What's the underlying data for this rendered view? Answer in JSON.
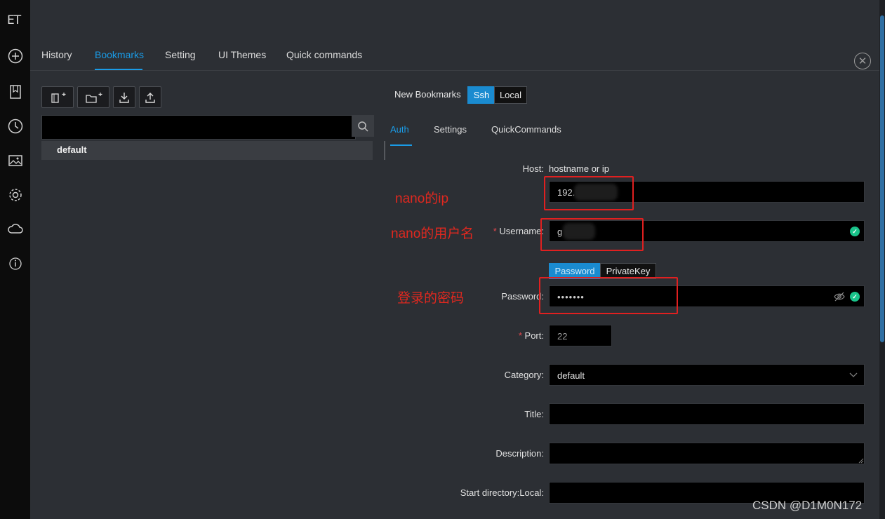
{
  "rail": {
    "logo": "ET",
    "icons": [
      "add-icon",
      "bookmark-icon",
      "history-icon",
      "image-icon",
      "settings-icon",
      "cloud-sync-icon",
      "info-icon"
    ]
  },
  "tabs": {
    "items": [
      "History",
      "Bookmarks",
      "Setting",
      "UI Themes",
      "Quick commands"
    ],
    "active": "Bookmarks",
    "close_glyph": "✕"
  },
  "left": {
    "search_placeholder": "",
    "tree": [
      {
        "label": "default"
      }
    ]
  },
  "form": {
    "new_bookmarks": "New Bookmarks",
    "type_options": [
      "Ssh",
      "Local"
    ],
    "type_selected": "Ssh",
    "subtabs": [
      "Auth",
      "Settings",
      "QuickCommands"
    ],
    "subtab_active": "Auth",
    "host": {
      "label": "Host",
      "hint": "hostname or ip",
      "value": "192."
    },
    "username": {
      "label": "Username",
      "value": "g"
    },
    "auth_type": {
      "options": [
        "Password",
        "PrivateKey"
      ],
      "selected": "Password"
    },
    "password": {
      "label": "Password",
      "value": "•••••••"
    },
    "port": {
      "label": "Port",
      "value": "22"
    },
    "category": {
      "label": "Category",
      "value": "default"
    },
    "title": {
      "label": "Title",
      "value": ""
    },
    "description": {
      "label": "Description",
      "value": ""
    },
    "start_directory": {
      "label": "Start directory:Local",
      "value": ""
    }
  },
  "annotations": {
    "host_note": "nano的ip",
    "username_note": "nano的用户名",
    "password_note": "登录的密码"
  },
  "watermark": "CSDN @D1M0N172",
  "colors": {
    "accent": "#1a9be6",
    "valid": "#19c38a",
    "annotation": "#e0281f"
  }
}
